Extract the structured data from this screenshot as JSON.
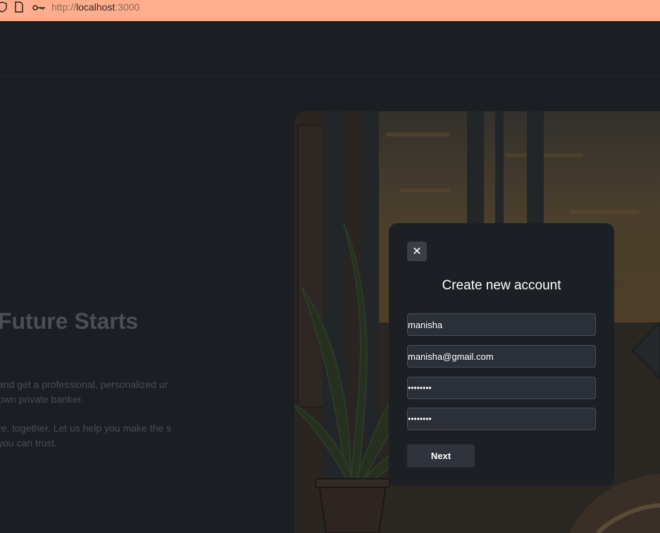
{
  "browser": {
    "url_scheme": "http://",
    "url_host": "localhost",
    "url_port": ":3000",
    "icons": [
      "shield-icon",
      "page-icon",
      "key-icon"
    ]
  },
  "hero": {
    "title": "Future Starts",
    "paragraph1": "and get a professional, personalized ur own private banker.",
    "paragraph2": "re, together. Let us help you make the s you can trust."
  },
  "modal": {
    "close_label": "✕",
    "title": "Create new account",
    "fields": {
      "name": "manisha",
      "email": "manisha@gmail.com",
      "password": "••••••••",
      "confirm_password": "••••••••"
    },
    "next_label": "Next"
  },
  "colors": {
    "browser_bar": "#ffad8c",
    "background": "#1b1e22",
    "modal_bg": "#1c1f23",
    "input_bg": "#2b3038",
    "button_bg": "#2f343c"
  }
}
